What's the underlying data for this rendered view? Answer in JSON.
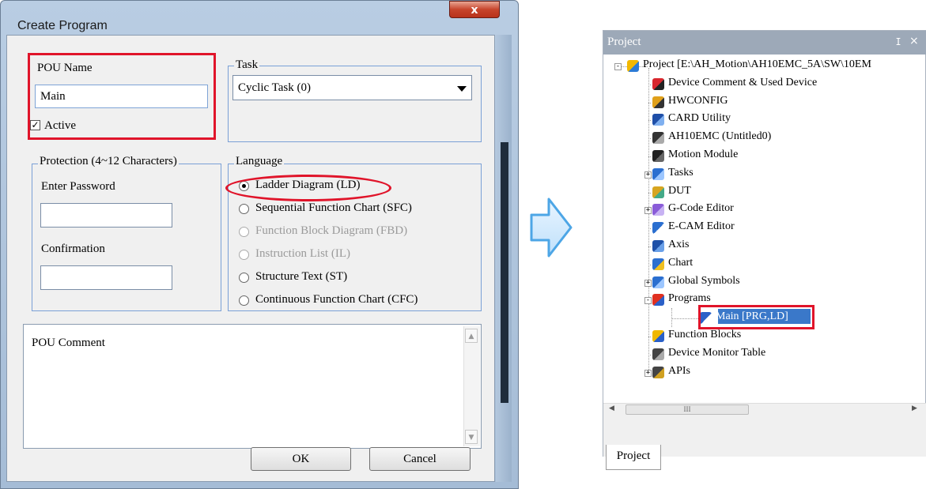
{
  "dialog": {
    "title": "Create Program",
    "close_label": "x",
    "pou_name_label": "POU Name",
    "pou_name_value": "Main",
    "active_label": "Active",
    "active_checked": true,
    "task_label": "Task",
    "task_value": "Cyclic Task (0)",
    "protection_label": "Protection (4~12 Characters)",
    "password_label": "Enter Password",
    "confirmation_label": "Confirmation",
    "language_label": "Language",
    "languages": [
      {
        "label": "Ladder Diagram (LD)",
        "selected": true,
        "enabled": true
      },
      {
        "label": "Sequential Function Chart (SFC)",
        "selected": false,
        "enabled": true
      },
      {
        "label": "Function Block Diagram (FBD)",
        "selected": false,
        "enabled": false
      },
      {
        "label": "Instruction List (IL)",
        "selected": false,
        "enabled": false
      },
      {
        "label": "Structure Text (ST)",
        "selected": false,
        "enabled": true
      },
      {
        "label": "Continuous Function Chart (CFC)",
        "selected": false,
        "enabled": true
      }
    ],
    "comment_label": "POU Comment",
    "ok_label": "OK",
    "cancel_label": "Cancel"
  },
  "project_panel": {
    "title": "Project",
    "pin_icon": "pin-icon",
    "close_icon": "close-icon",
    "tab_label": "Project",
    "scroll_thumb_label": "III",
    "tree": [
      {
        "label": "Project [E:\\AH_Motion\\AH10EMC_5A\\SW\\10EM",
        "icon": "project-icon",
        "expander": "-"
      },
      {
        "label": "Device Comment & Used Device",
        "icon": "device-comment-icon"
      },
      {
        "label": "HWCONFIG",
        "icon": "hwconfig-icon"
      },
      {
        "label": "CARD Utility",
        "icon": "card-utility-icon"
      },
      {
        "label": "AH10EMC  (Untitled0)",
        "icon": "controller-icon"
      },
      {
        "label": "Motion Module",
        "icon": "motion-module-icon"
      },
      {
        "label": "Tasks",
        "icon": "tasks-icon",
        "expander": "+"
      },
      {
        "label": "DUT",
        "icon": "dut-icon"
      },
      {
        "label": "G-Code Editor",
        "icon": "gcode-icon",
        "expander": "+"
      },
      {
        "label": "E-CAM Editor",
        "icon": "ecam-icon"
      },
      {
        "label": "Axis",
        "icon": "axis-icon"
      },
      {
        "label": "Chart",
        "icon": "chart-icon"
      },
      {
        "label": "Global Symbols",
        "icon": "global-symbols-icon",
        "expander": "+"
      },
      {
        "label": "Programs",
        "icon": "programs-icon",
        "expander": "-"
      },
      {
        "label": "Main [PRG,LD]",
        "icon": "program-item-icon",
        "selected": true
      },
      {
        "label": "Function Blocks",
        "icon": "function-blocks-icon"
      },
      {
        "label": "Device Monitor Table",
        "icon": "monitor-table-icon"
      },
      {
        "label": "APIs",
        "icon": "apis-icon",
        "expander": "+"
      }
    ]
  },
  "colors": {
    "highlight_red": "#e0142a",
    "selection_blue": "#3a78c9",
    "panel_header": "#9da9b8",
    "arrow_blue": "#4da6e6"
  }
}
